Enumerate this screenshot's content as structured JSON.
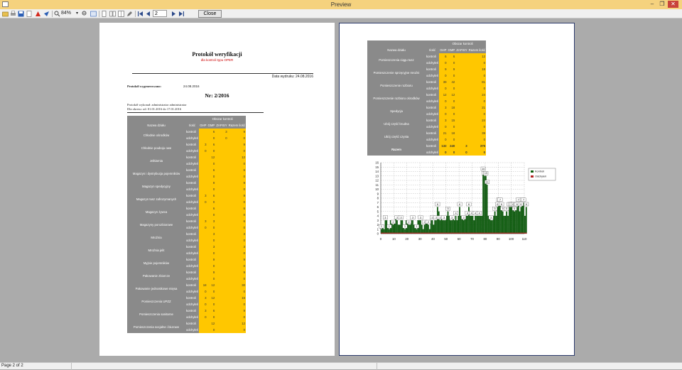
{
  "window": {
    "title": "Preview"
  },
  "toolbar": {
    "zoom": "84%",
    "page": "2",
    "close_label": "Close"
  },
  "page1": {
    "title": "Protokół weryfikacji",
    "subtitle": "dla kontroli typu OPER",
    "print_date": "Data wydruku: 24.08.2016",
    "generated_label": "Protokół wygenerowano:",
    "generated_value": "24.08.2016",
    "nr": "Nr: 2/2016",
    "made_by": "Protokół wykonał: administrator administrator",
    "period": "Dla okresu: od: 01.01.2016 do 17.01.2016",
    "table": {
      "group_header": "Obszar kontroli",
      "headers": [
        "Nazwa działu",
        "Ilość",
        "GHP",
        "GMP",
        "ZAPISY",
        "Razem ilość"
      ],
      "row_types": [
        "kontroli",
        "odchyleń"
      ],
      "rows": [
        {
          "name": "Chłodnie ośrodków",
          "k": [
            "",
            "6",
            "3",
            "9"
          ],
          "o": [
            "",
            "0",
            "0",
            "0"
          ]
        },
        {
          "name": "Chłodnie pouboju owe",
          "k": [
            "3",
            "6",
            "",
            "9"
          ],
          "o": [
            "0",
            "0",
            "",
            "0"
          ]
        },
        {
          "name": "Jelitiarnia",
          "k": [
            "",
            "12",
            "",
            "12"
          ],
          "o": [
            "",
            "0",
            "",
            "0"
          ]
        },
        {
          "name": "Magazyn i dystrybucja pojemników",
          "k": [
            "",
            "6",
            "",
            "6"
          ],
          "o": [
            "",
            "0",
            "",
            "0"
          ]
        },
        {
          "name": "Magazyn spedycyjny",
          "k": [
            "",
            "9",
            "",
            "9"
          ],
          "o": [
            "",
            "0",
            "",
            "0"
          ]
        },
        {
          "name": "Magazyn tusz zafrozymanych",
          "k": [
            "3",
            "6",
            "",
            "9"
          ],
          "o": [
            "0",
            "0",
            "",
            "0"
          ]
        },
        {
          "name": "Magazyn żywca",
          "k": [
            "",
            "6",
            "",
            "6"
          ],
          "o": [
            "",
            "0",
            "",
            "0"
          ]
        },
        {
          "name": "Magazyny porozbiorowe",
          "k": [
            "3",
            "3",
            "",
            "6"
          ],
          "o": [
            "0",
            "0",
            "",
            "0"
          ]
        },
        {
          "name": "Mroźnia",
          "k": [
            "",
            "3",
            "",
            "3"
          ],
          "o": [
            "",
            "0",
            "",
            "0"
          ]
        },
        {
          "name": "Mroźnia jelit",
          "k": [
            "",
            "3",
            "",
            "3"
          ],
          "o": [
            "",
            "0",
            "",
            "0"
          ]
        },
        {
          "name": "Myjnie pojemników",
          "k": [
            "",
            "9",
            "",
            "9"
          ],
          "o": [
            "",
            "0",
            "",
            "0"
          ]
        },
        {
          "name": "Pakowanie zbiorcze",
          "k": [
            "",
            "9",
            "",
            "9"
          ],
          "o": [
            "",
            "0",
            "",
            "0"
          ]
        },
        {
          "name": "Pakowanie jednostkowe mięsa",
          "k": [
            "18",
            "12",
            "",
            "30"
          ],
          "o": [
            "0",
            "0",
            "",
            "0"
          ]
        },
        {
          "name": "Pomieszczenia UPZZ",
          "k": [
            "3",
            "12",
            "",
            "15"
          ],
          "o": [
            "0",
            "0",
            "",
            "0"
          ]
        },
        {
          "name": "Pomieszczenia sanitarne",
          "k": [
            "3",
            "6",
            "",
            "9"
          ],
          "o": [
            "0",
            "0",
            "",
            "0"
          ]
        },
        {
          "name": "Pomieszczenia socjalne i biurowe",
          "k": [
            "",
            "12",
            "",
            "12"
          ],
          "o": [
            "",
            "0",
            "",
            "0"
          ]
        }
      ]
    }
  },
  "page2": {
    "table": {
      "group_header": "Obszar kontroli",
      "headers": [
        "Nazwa działu",
        "Ilość",
        "GHP",
        "GMP",
        "ZAPISY",
        "Razem ilość"
      ],
      "row_types": [
        "kontroli",
        "odchyleń"
      ],
      "rows": [
        {
          "name": "Pomieszczenia ciągu tusz",
          "k": [
            "6",
            "6",
            "",
            "12"
          ],
          "o": [
            "0",
            "0",
            "",
            "0"
          ]
        },
        {
          "name": "Pomieszczenie sprzęcyjne mroźni",
          "k": [
            "9",
            "9",
            "",
            "18"
          ],
          "o": [
            "0",
            "0",
            "",
            "0"
          ]
        },
        {
          "name": "Pomieszczenie rozbioru",
          "k": [
            "39",
            "42",
            "",
            "81"
          ],
          "o": [
            "0",
            "0",
            "",
            "0"
          ]
        },
        {
          "name": "Pomieszczenie rozbioru ośrodków",
          "k": [
            "12",
            "12",
            "",
            "24"
          ],
          "o": [
            "0",
            "0",
            "",
            "0"
          ]
        },
        {
          "name": "Spedycja",
          "k": [
            "3",
            "18",
            "",
            "21"
          ],
          "o": [
            "0",
            "0",
            "",
            "0"
          ]
        },
        {
          "name": "Ubój część brudna",
          "k": [
            "3",
            "15",
            "",
            "24"
          ],
          "o": [
            "0",
            "0",
            "",
            "0"
          ]
        },
        {
          "name": "Ubój część czysta",
          "k": [
            "21",
            "18",
            "",
            "39"
          ],
          "o": [
            "0",
            "0",
            "",
            "0"
          ]
        }
      ],
      "total": {
        "name": "Razem",
        "k": [
          "132",
          "240",
          "3",
          "375"
        ],
        "o": [
          "0",
          "0",
          "0",
          "0"
        ]
      }
    }
  },
  "chart_data": {
    "type": "bar",
    "x_range": [
      0,
      110
    ],
    "y_range": [
      0,
      16
    ],
    "x_ticks": [
      0,
      10,
      20,
      30,
      40,
      50,
      60,
      70,
      80,
      90,
      100,
      110
    ],
    "y_ticks": [
      0,
      1,
      2,
      3,
      4,
      5,
      6,
      7,
      8,
      9,
      10,
      11,
      12,
      13,
      14,
      15,
      16
    ],
    "grid": true,
    "legend": "right",
    "colors": {
      "kontroli": "#0b5e0b",
      "odchylen": "#b22222"
    },
    "series": [
      {
        "name": "Kontroli",
        "values": [
          1,
          2,
          1,
          3,
          3,
          2,
          1,
          3,
          3,
          2,
          3,
          4,
          3,
          2,
          2,
          3,
          3,
          2,
          1,
          3,
          3,
          2,
          2,
          3,
          3,
          2,
          2,
          1,
          3,
          3,
          3,
          2,
          1,
          2,
          3,
          3,
          2,
          1,
          3,
          3,
          2,
          3,
          3,
          6,
          5,
          3,
          4,
          3,
          3,
          3,
          4,
          5,
          4,
          3,
          3,
          4,
          3,
          4,
          3,
          4,
          6,
          4,
          4,
          3,
          4,
          4,
          4,
          6,
          4,
          4,
          4,
          3,
          4,
          4,
          4,
          4,
          4,
          4,
          14,
          13,
          13,
          11,
          4,
          4,
          3,
          3,
          4,
          5,
          4,
          6,
          7,
          7,
          6,
          5,
          4,
          4,
          5,
          4,
          6,
          6,
          6,
          6,
          5,
          6,
          6,
          7,
          5,
          6,
          7,
          7,
          4,
          6
        ]
      },
      {
        "name": "Odchyleń",
        "values": []
      }
    ]
  }
}
